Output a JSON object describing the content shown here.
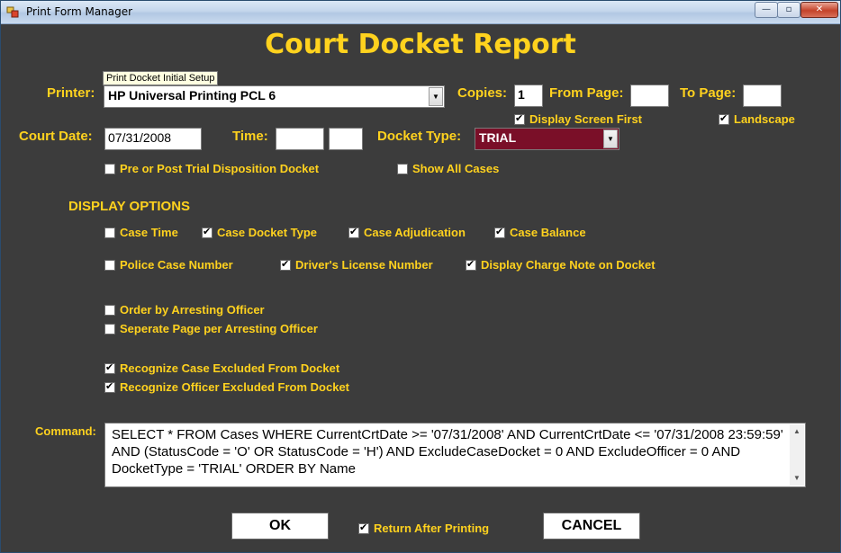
{
  "window": {
    "title": "Print Form Manager",
    "minimize_glyph": "—",
    "maximize_glyph": "▫",
    "close_glyph": "✕"
  },
  "heading": "Court Docket Report",
  "tooltip": "Print Docket Initial Setup",
  "printer": {
    "label": "Printer:",
    "value": "HP Universal Printing PCL 6"
  },
  "copies": {
    "label": "Copies:",
    "value": "1"
  },
  "from_page": {
    "label": "From Page:",
    "value": ""
  },
  "to_page": {
    "label": "To Page:",
    "value": ""
  },
  "display_screen_first": {
    "label": "Display Screen First",
    "checked": true
  },
  "landscape": {
    "label": "Landscape",
    "checked": true
  },
  "court_date": {
    "label": "Court Date:",
    "value": "07/31/2008"
  },
  "time": {
    "label": "Time:",
    "value1": "",
    "value2": ""
  },
  "docket_type": {
    "label": "Docket Type:",
    "value": "TRIAL"
  },
  "pre_post_trial": {
    "label": "Pre or Post Trial Disposition Docket",
    "checked": false
  },
  "show_all_cases": {
    "label": "Show All Cases",
    "checked": false
  },
  "display_options": {
    "heading": "DISPLAY OPTIONS",
    "case_time": {
      "label": "Case Time",
      "checked": false
    },
    "case_docket_type": {
      "label": "Case Docket Type",
      "checked": true
    },
    "case_adjudication": {
      "label": "Case Adjudication",
      "checked": true
    },
    "case_balance": {
      "label": "Case Balance",
      "checked": true
    },
    "police_case_number": {
      "label": "Police Case Number",
      "checked": false
    },
    "drivers_license_number": {
      "label": "Driver's License Number",
      "checked": true
    },
    "display_charge_note": {
      "label": "Display Charge Note on Docket",
      "checked": true
    },
    "order_by_arresting_officer": {
      "label": "Order by Arresting Officer",
      "checked": false
    },
    "separate_page_per_officer": {
      "label": "Seperate Page per Arresting Officer",
      "checked": false
    },
    "recognize_case_excluded": {
      "label": "Recognize Case Excluded From Docket",
      "checked": true
    },
    "recognize_officer_excluded": {
      "label": "Recognize Officer Excluded From Docket",
      "checked": true
    }
  },
  "command": {
    "label": "Command:",
    "text": "SELECT * FROM Cases  WHERE CurrentCrtDate >= '07/31/2008' AND CurrentCrtDate <= '07/31/2008 23:59:59' AND (StatusCode = 'O' OR StatusCode = 'H')  AND ExcludeCaseDocket = 0  AND ExcludeOfficer = 0  AND DocketType = 'TRIAL'  ORDER BY Name"
  },
  "ok_label": "OK",
  "return_after_printing": {
    "label": "Return After Printing",
    "checked": true
  },
  "cancel_label": "CANCEL",
  "colors": {
    "background": "#3c3c3c",
    "label": "#ffd21e",
    "docket_type_fill": "#7a0f28"
  }
}
